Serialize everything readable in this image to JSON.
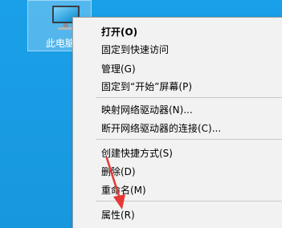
{
  "desktop": {
    "background_color": "#1a9ee6",
    "icon": {
      "name": "computer-icon",
      "label": "此电脑"
    }
  },
  "context_menu": {
    "items": [
      {
        "id": "open",
        "label": "打开(O)",
        "bold": true
      },
      {
        "id": "pin-quick-access",
        "label": "固定到快速访问"
      },
      {
        "id": "manage",
        "label": "管理(G)"
      },
      {
        "id": "pin-start",
        "label": "固定到“开始”屏幕(P)"
      },
      {
        "id": "map-network-drive",
        "label": "映射网络驱动器(N)..."
      },
      {
        "id": "disconnect-network-drive",
        "label": "断开网络驱动器的连接(C)..."
      },
      {
        "id": "create-shortcut",
        "label": "创建快捷方式(S)"
      },
      {
        "id": "delete",
        "label": "删除(D)"
      },
      {
        "id": "rename",
        "label": "重命名(M)"
      },
      {
        "id": "properties",
        "label": "属性(R)"
      }
    ]
  },
  "annotation": {
    "type": "arrow",
    "color": "#e53935",
    "points_to": "properties"
  }
}
